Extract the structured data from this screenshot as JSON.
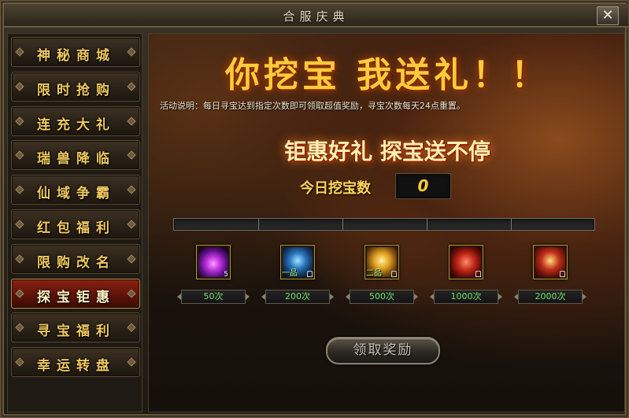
{
  "window": {
    "title": "合服庆典",
    "close_label": "✕"
  },
  "sidebar": {
    "items": [
      {
        "label": "神秘商城",
        "active": false
      },
      {
        "label": "限时抢购",
        "active": false
      },
      {
        "label": "连充大礼",
        "active": false
      },
      {
        "label": "瑞兽降临",
        "active": false
      },
      {
        "label": "仙域争霸",
        "active": false
      },
      {
        "label": "红包福利",
        "active": false
      },
      {
        "label": "限购改名",
        "active": false
      },
      {
        "label": "探宝钜惠",
        "active": true
      },
      {
        "label": "寻宝福利",
        "active": false
      },
      {
        "label": "幸运转盘",
        "active": false
      }
    ]
  },
  "main": {
    "headline": "你挖宝 我送礼！！",
    "description": "活动说明：每日寻宝达到指定次数即可领取超值奖励，寻宝次数每天24点重置。",
    "slogan": "钜惠好礼 探宝送不停",
    "count_label": "今日挖宝数",
    "count_value": "0",
    "progress": 0,
    "rewards": [
      {
        "icon": "purple-flame-icon",
        "grade": "",
        "quantity": "5",
        "requirement": "50次"
      },
      {
        "icon": "blue-helmet-icon",
        "grade": "一品",
        "quantity": "",
        "requirement": "200次"
      },
      {
        "icon": "gold-armor-icon",
        "grade": "二品",
        "quantity": "",
        "requirement": "500次"
      },
      {
        "icon": "red-treasure-chest-icon",
        "grade": "",
        "quantity": "",
        "requirement": "1000次"
      },
      {
        "icon": "red-gold-armor-icon",
        "grade": "",
        "quantity": "",
        "requirement": "2000次"
      }
    ],
    "claim_label": "领取奖励"
  },
  "colors": {
    "accent": "#ffcb3a",
    "active_tab": "#8a2112",
    "requirement_text": "#6fe06a"
  }
}
